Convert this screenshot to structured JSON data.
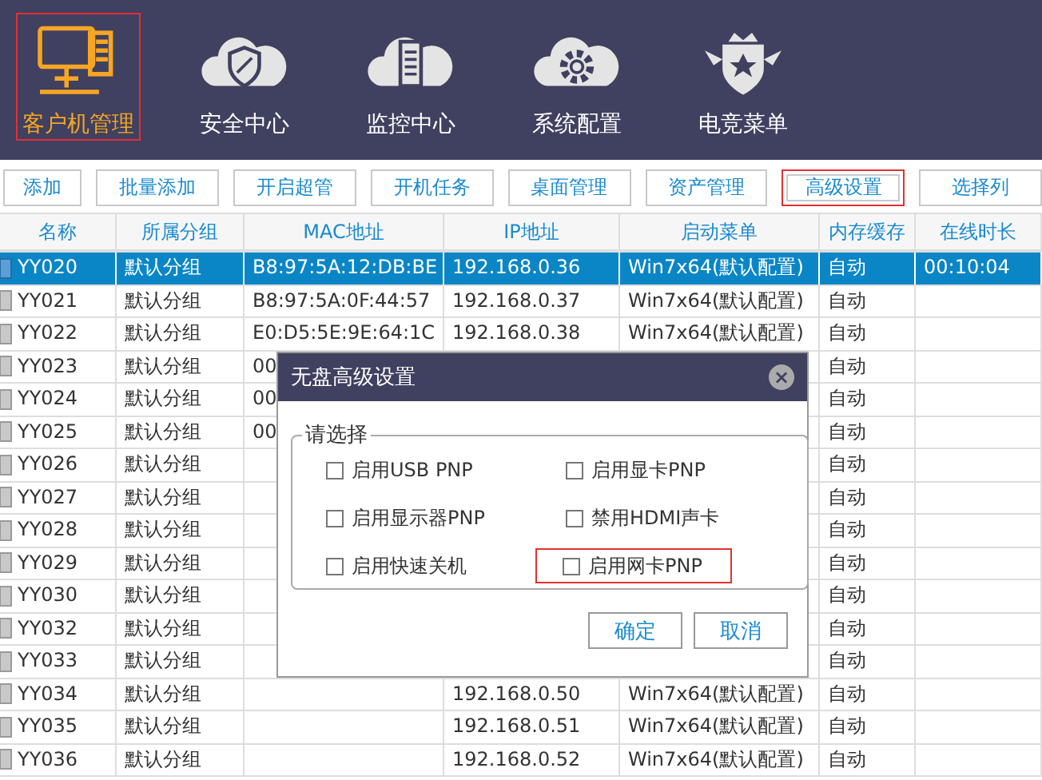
{
  "nav": [
    {
      "label": "客户机管理",
      "kind": "computer",
      "selected": true
    },
    {
      "label": "安全中心",
      "kind": "shield",
      "selected": false
    },
    {
      "label": "监控中心",
      "kind": "server",
      "selected": false
    },
    {
      "label": "系统配置",
      "kind": "gear",
      "selected": false
    },
    {
      "label": "电竞菜单",
      "kind": "crown",
      "selected": false
    }
  ],
  "toolbar": [
    {
      "label": "添加",
      "highlighted": false
    },
    {
      "label": "批量添加",
      "highlighted": false
    },
    {
      "label": "开启超管",
      "highlighted": false
    },
    {
      "label": "开机任务",
      "highlighted": false
    },
    {
      "label": "桌面管理",
      "highlighted": false
    },
    {
      "label": "资产管理",
      "highlighted": false
    },
    {
      "label": "高级设置",
      "highlighted": true
    },
    {
      "label": "选择列",
      "highlighted": false
    }
  ],
  "table": {
    "columns": [
      "名称",
      "所属分组",
      "MAC地址",
      "IP地址",
      "启动菜单",
      "内存缓存",
      "在线时长"
    ],
    "rows": [
      {
        "selected": true,
        "cells": [
          "YY020",
          "默认分组",
          "B8:97:5A:12:DB:BE",
          "192.168.0.36",
          "Win7x64(默认配置)",
          "自动",
          "00:10:04"
        ]
      },
      {
        "selected": false,
        "cells": [
          "YY021",
          "默认分组",
          "B8:97:5A:0F:44:57",
          "192.168.0.37",
          "Win7x64(默认配置)",
          "自动",
          null
        ]
      },
      {
        "selected": false,
        "cells": [
          "YY022",
          "默认分组",
          "E0:D5:5E:9E:64:1C",
          "192.168.0.38",
          "Win7x64(默认配置)",
          "自动",
          null
        ]
      },
      {
        "selected": false,
        "cells": [
          "YY023",
          "默认分组",
          "00",
          null,
          null,
          "自动",
          null
        ]
      },
      {
        "selected": false,
        "cells": [
          "YY024",
          "默认分组",
          "00",
          null,
          null,
          "自动",
          null
        ]
      },
      {
        "selected": false,
        "cells": [
          "YY025",
          "默认分组",
          "00",
          null,
          null,
          "自动",
          null
        ]
      },
      {
        "selected": false,
        "cells": [
          "YY026",
          "默认分组",
          null,
          null,
          null,
          "自动",
          null
        ]
      },
      {
        "selected": false,
        "cells": [
          "YY027",
          "默认分组",
          null,
          null,
          null,
          "自动",
          null
        ]
      },
      {
        "selected": false,
        "cells": [
          "YY028",
          "默认分组",
          null,
          null,
          null,
          "自动",
          null
        ]
      },
      {
        "selected": false,
        "cells": [
          "YY029",
          "默认分组",
          null,
          null,
          null,
          "自动",
          null
        ]
      },
      {
        "selected": false,
        "cells": [
          "YY030",
          "默认分组",
          null,
          null,
          null,
          "自动",
          null
        ]
      },
      {
        "selected": false,
        "cells": [
          "YY032",
          "默认分组",
          null,
          null,
          null,
          "自动",
          null
        ]
      },
      {
        "selected": false,
        "cells": [
          "YY033",
          "默认分组",
          null,
          null,
          null,
          "自动",
          null
        ]
      },
      {
        "selected": false,
        "cells": [
          "YY034",
          "默认分组",
          null,
          "192.168.0.50",
          "Win7x64(默认配置)",
          "自动",
          null
        ]
      },
      {
        "selected": false,
        "cells": [
          "YY035",
          "默认分组",
          null,
          "192.168.0.51",
          "Win7x64(默认配置)",
          "自动",
          null
        ]
      },
      {
        "selected": false,
        "cells": [
          "YY036",
          "默认分组",
          null,
          "192.168.0.52",
          "Win7x64(默认配置)",
          "自动",
          null
        ]
      }
    ]
  },
  "dialog": {
    "title": "无盘高级设置",
    "close": "×",
    "group_label": "请选择",
    "options": [
      {
        "label": "启用USB PNP",
        "checked": false,
        "highlighted": false
      },
      {
        "label": "启用显卡PNP",
        "checked": false,
        "highlighted": false
      },
      {
        "label": "启用显示器PNP",
        "checked": false,
        "highlighted": false
      },
      {
        "label": "禁用HDMI声卡",
        "checked": false,
        "highlighted": false
      },
      {
        "label": "启用快速关机",
        "checked": false,
        "highlighted": false
      },
      {
        "label": "启用网卡PNP",
        "checked": false,
        "highlighted": true
      }
    ],
    "buttons": [
      "确定",
      "取消"
    ]
  }
}
